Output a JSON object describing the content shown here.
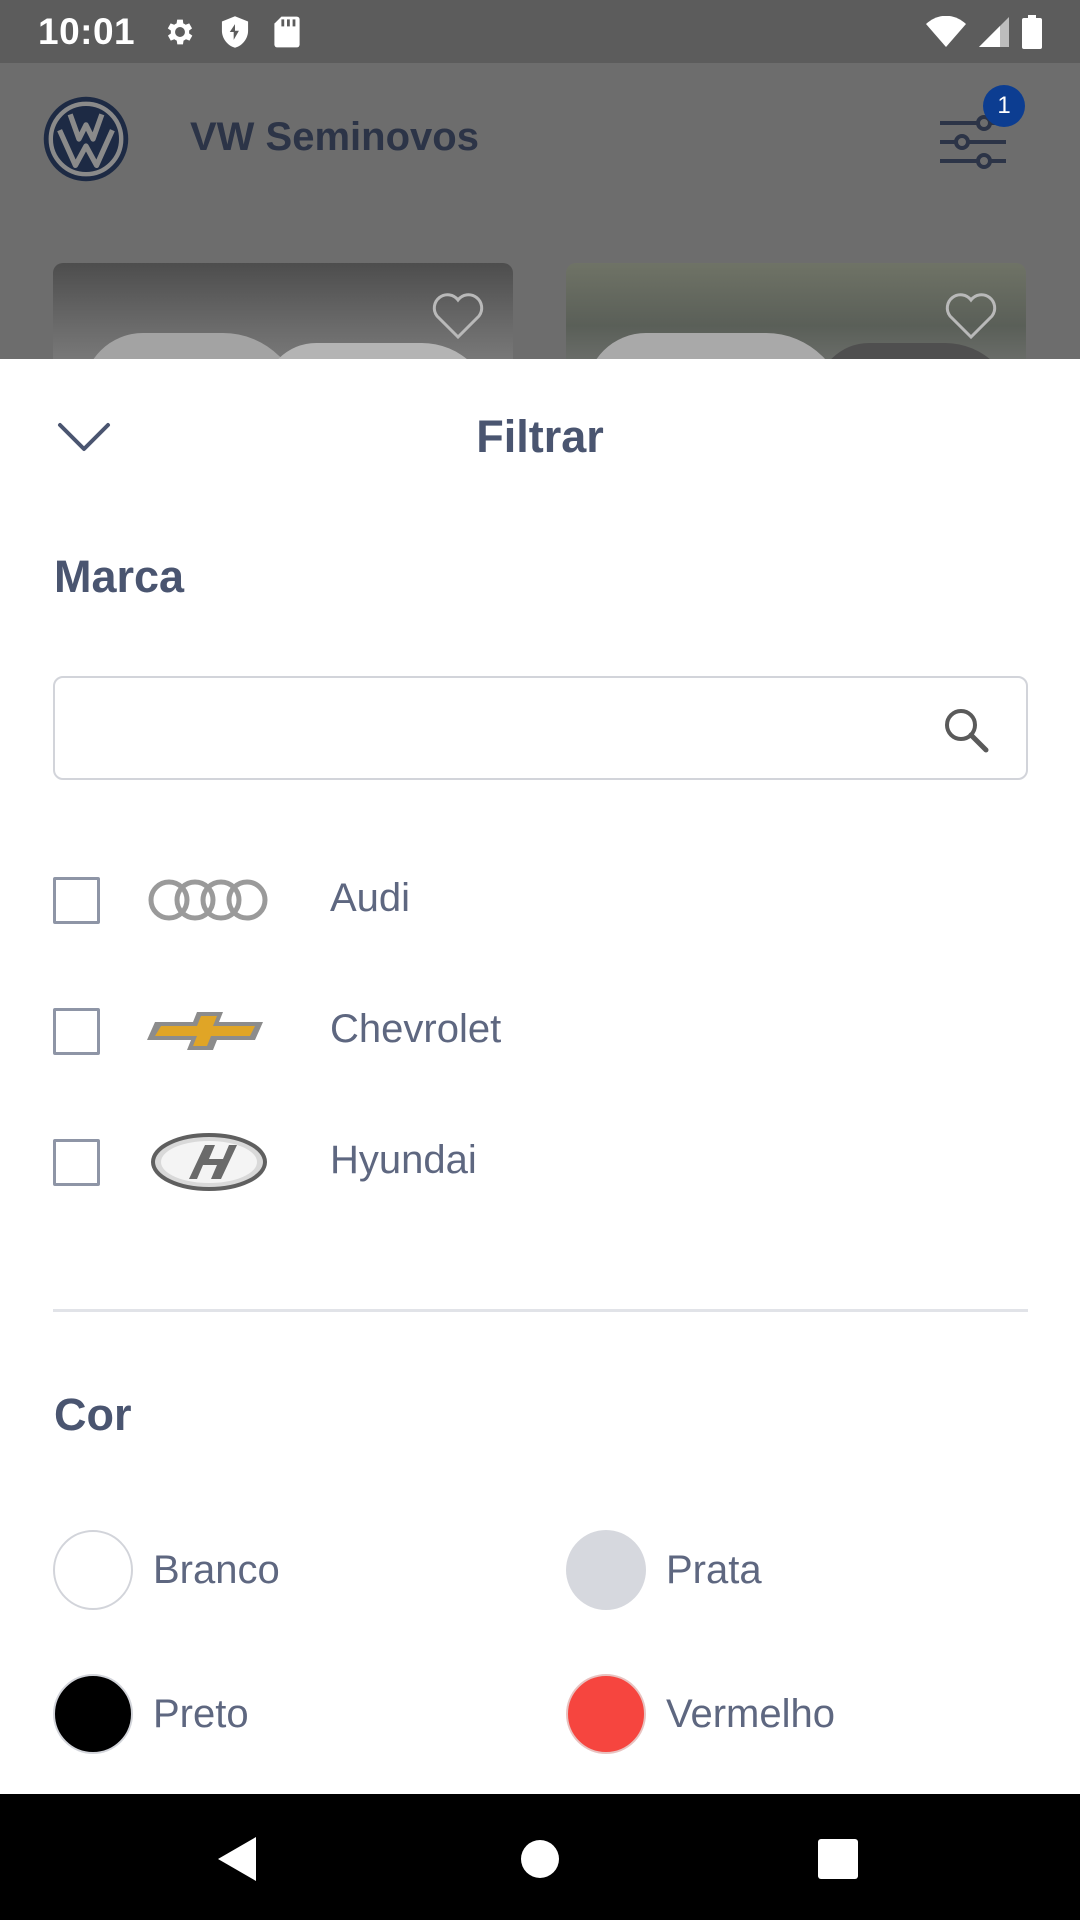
{
  "status_bar": {
    "time": "10:01",
    "icons_left": [
      "settings-icon",
      "shield-icon",
      "sd-card-icon"
    ],
    "icons_right": [
      "wifi-icon",
      "signal-icon",
      "battery-icon"
    ]
  },
  "app": {
    "title": "VW Seminovos",
    "filter_badge": "1",
    "logo": "vw-logo"
  },
  "sheet": {
    "title": "Filtrar",
    "brand_section": {
      "title": "Marca",
      "search": {
        "value": "",
        "placeholder": ""
      },
      "brands": [
        {
          "label": "Audi",
          "logo": "audi-logo",
          "checked": false
        },
        {
          "label": "Chevrolet",
          "logo": "chevrolet-logo",
          "checked": false
        },
        {
          "label": "Hyundai",
          "logo": "hyundai-logo",
          "checked": false
        }
      ]
    },
    "color_section": {
      "title": "Cor",
      "colors": [
        {
          "label": "Branco",
          "swatch": "#ffffff"
        },
        {
          "label": "Prata",
          "swatch": "#d6d8de"
        },
        {
          "label": "Preto",
          "swatch": "#000000"
        },
        {
          "label": "Vermelho",
          "swatch": "#f6453f"
        }
      ]
    }
  },
  "theme": {
    "accent": "#0c3d91",
    "text": "#4a5570",
    "checkbox_border": "#8e95a6",
    "divider": "#e1e3e8"
  }
}
